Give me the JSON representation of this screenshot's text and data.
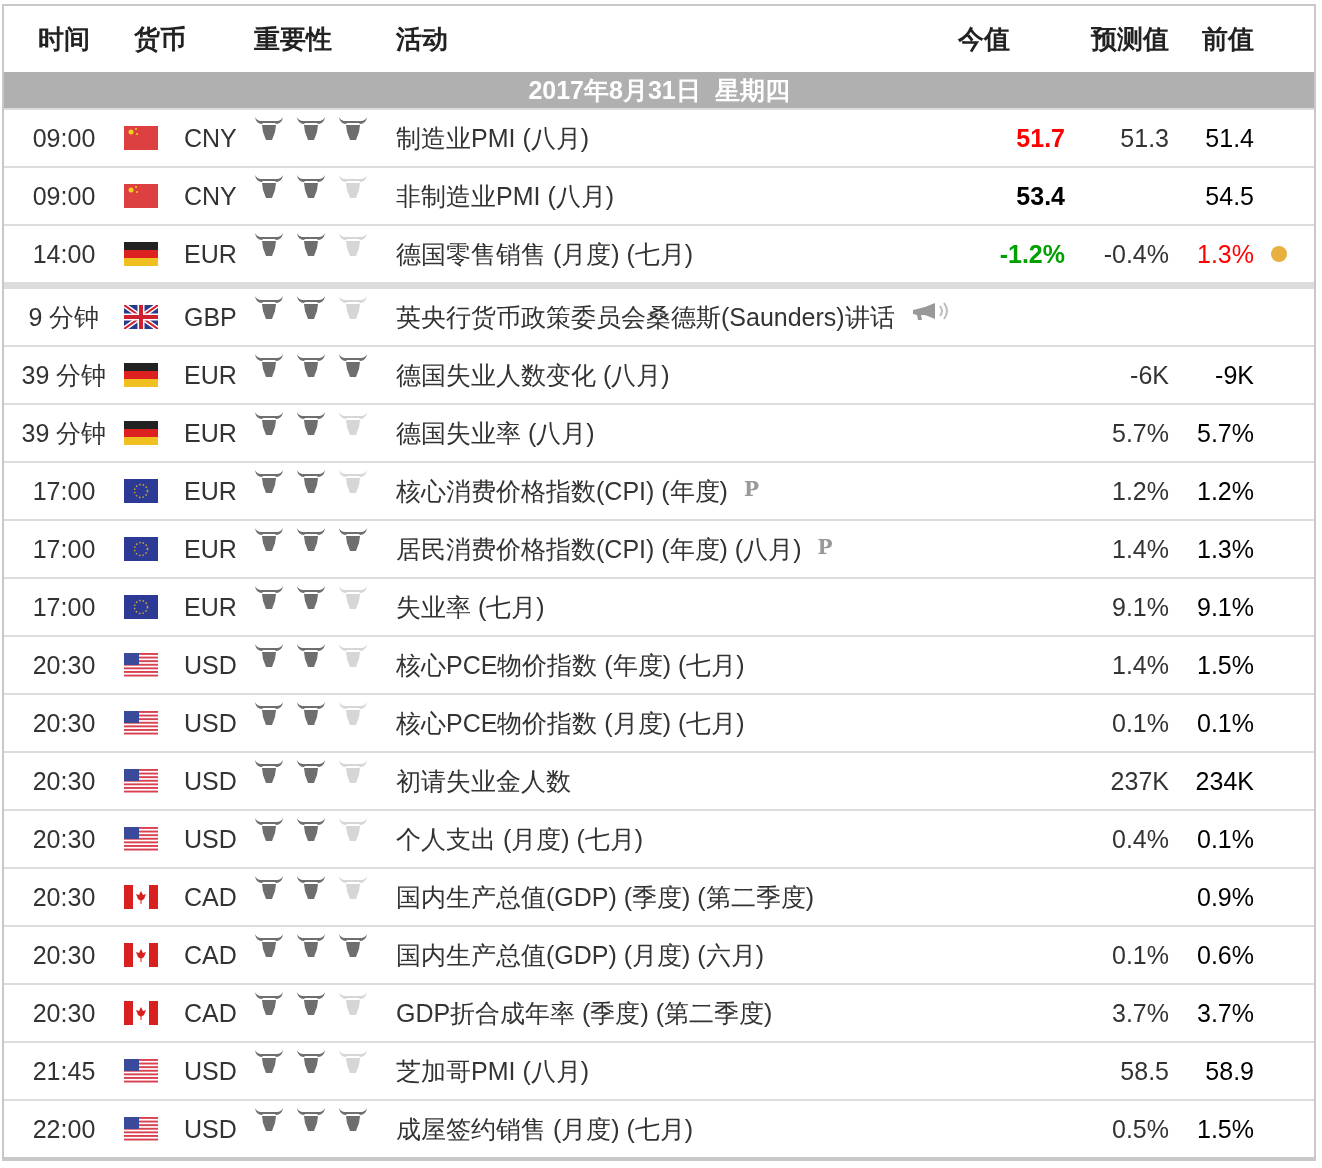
{
  "columns": [
    "时间",
    "货币",
    "重要性",
    "活动",
    "今值",
    "预测值",
    "前值"
  ],
  "date_bar": "2017年8月31日  星期四",
  "rows": [
    {
      "time": "09:00",
      "kind": "cn",
      "currency": "CNY",
      "stars": 3,
      "event": "制造业PMI (八月)",
      "actual": {
        "text": "51.7",
        "color": "#ff0000"
      },
      "forecast": "51.3",
      "previous": {
        "text": "51.4",
        "color": "#000000"
      },
      "divider_after": false
    },
    {
      "time": "09:00",
      "kind": "cn",
      "currency": "CNY",
      "stars": 2,
      "event": "非制造业PMI (八月)",
      "actual": {
        "text": "53.4",
        "color": "#000000"
      },
      "previous": {
        "text": "54.5",
        "color": "#000000"
      },
      "divider_after": false
    },
    {
      "time": "14:00",
      "kind": "de",
      "currency": "EUR",
      "stars": 2,
      "event": "德国零售销售 (月度) (七月)",
      "actual": {
        "text": "-1.2%",
        "color": "#00a000"
      },
      "forecast": "-0.4%",
      "previous": {
        "text": "1.3%",
        "color": "#ff0000"
      },
      "alert_dot": {
        "color": "#e8b13f"
      },
      "divider_after": true
    },
    {
      "time": "9 分钟",
      "kind": "gb",
      "currency": "GBP",
      "stars": 2,
      "event": "英央行货币政策委员会桑德斯(Saunders)讲话",
      "speech": true,
      "divider_after": false
    },
    {
      "time": "39 分钟",
      "kind": "de",
      "currency": "EUR",
      "stars": 3,
      "event": "德国失业人数变化 (八月)",
      "forecast": "-6K",
      "previous": {
        "text": "-9K",
        "color": "#000000"
      },
      "divider_after": false
    },
    {
      "time": "39 分钟",
      "kind": "de",
      "currency": "EUR",
      "stars": 2,
      "event": "德国失业率 (八月)",
      "forecast": "5.7%",
      "previous": {
        "text": "5.7%",
        "color": "#000000"
      },
      "divider_after": false
    },
    {
      "time": "17:00",
      "kind": "eu",
      "currency": "EUR",
      "stars": 2,
      "event": "核心消费价格指数(CPI) (年度)",
      "preliminary": "P",
      "forecast": "1.2%",
      "previous": {
        "text": "1.2%",
        "color": "#000000"
      },
      "divider_after": false
    },
    {
      "time": "17:00",
      "kind": "eu",
      "currency": "EUR",
      "stars": 3,
      "event": "居民消费价格指数(CPI) (年度) (八月)",
      "preliminary": "P",
      "forecast": "1.4%",
      "previous": {
        "text": "1.3%",
        "color": "#000000"
      },
      "divider_after": false
    },
    {
      "time": "17:00",
      "kind": "eu",
      "currency": "EUR",
      "stars": 2,
      "event": "失业率 (七月)",
      "forecast": "9.1%",
      "previous": {
        "text": "9.1%",
        "color": "#000000"
      },
      "divider_after": false
    },
    {
      "time": "20:30",
      "kind": "us",
      "currency": "USD",
      "stars": 2,
      "event": "核心PCE物价指数 (年度) (七月)",
      "forecast": "1.4%",
      "previous": {
        "text": "1.5%",
        "color": "#000000"
      },
      "divider_after": false
    },
    {
      "time": "20:30",
      "kind": "us",
      "currency": "USD",
      "stars": 2,
      "event": "核心PCE物价指数 (月度) (七月)",
      "forecast": "0.1%",
      "previous": {
        "text": "0.1%",
        "color": "#000000"
      },
      "divider_after": false
    },
    {
      "time": "20:30",
      "kind": "us",
      "currency": "USD",
      "stars": 2,
      "event": "初请失业金人数",
      "forecast": "237K",
      "previous": {
        "text": "234K",
        "color": "#000000"
      },
      "divider_after": false
    },
    {
      "time": "20:30",
      "kind": "us",
      "currency": "USD",
      "stars": 2,
      "event": "个人支出 (月度) (七月)",
      "forecast": "0.4%",
      "previous": {
        "text": "0.1%",
        "color": "#000000"
      },
      "divider_after": false
    },
    {
      "time": "20:30",
      "kind": "ca",
      "currency": "CAD",
      "stars": 2,
      "event": "国内生产总值(GDP) (季度) (第二季度)",
      "previous": {
        "text": "0.9%",
        "color": "#000000"
      },
      "divider_after": false
    },
    {
      "time": "20:30",
      "kind": "ca",
      "currency": "CAD",
      "stars": 3,
      "event": "国内生产总值(GDP) (月度) (六月)",
      "forecast": "0.1%",
      "previous": {
        "text": "0.6%",
        "color": "#000000"
      },
      "divider_after": false
    },
    {
      "time": "20:30",
      "kind": "ca",
      "currency": "CAD",
      "stars": 2,
      "event": "GDP折合成年率 (季度) (第二季度)",
      "forecast": "3.7%",
      "previous": {
        "text": "3.7%",
        "color": "#000000"
      },
      "divider_after": false
    },
    {
      "time": "21:45",
      "kind": "us",
      "currency": "USD",
      "stars": 2,
      "event": "芝加哥PMI (八月)",
      "forecast": "58.5",
      "previous": {
        "text": "58.9",
        "color": "#000000"
      },
      "divider_after": false
    },
    {
      "time": "22:00",
      "kind": "us",
      "currency": "USD",
      "stars": 3,
      "event": "成屋签约销售 (月度) (七月)",
      "forecast": "0.5%",
      "previous": {
        "text": "1.5%",
        "color": "#000000"
      },
      "divider_after": false
    }
  ]
}
